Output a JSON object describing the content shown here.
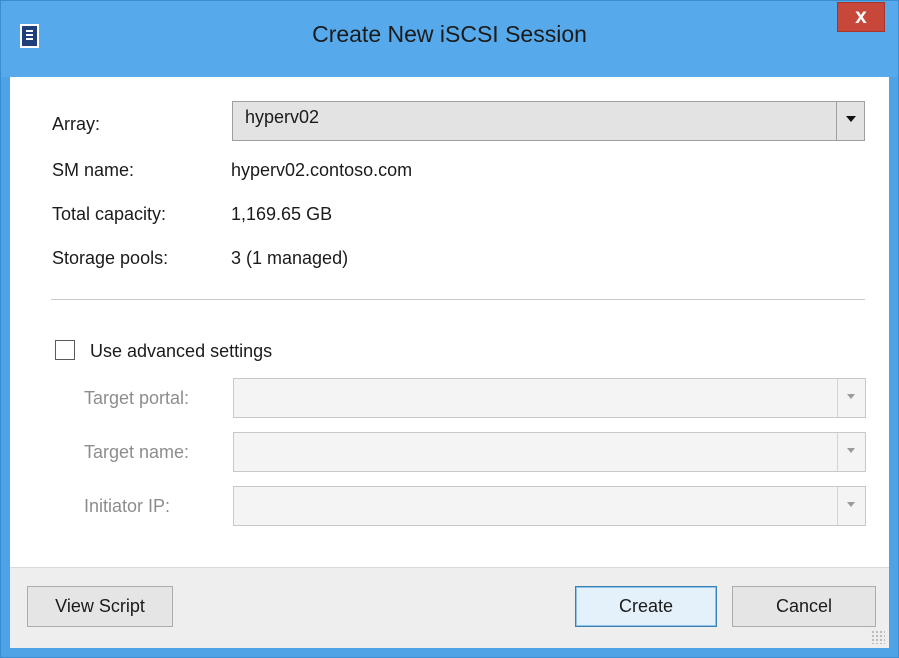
{
  "window": {
    "title": "Create New iSCSI Session",
    "close_label": "x"
  },
  "array": {
    "label": "Array:",
    "selected": "hyperv02"
  },
  "info": {
    "sm_name_label": "SM name:",
    "sm_name_value": "hyperv02.contoso.com",
    "total_capacity_label": "Total capacity:",
    "total_capacity_value": "1,169.65 GB",
    "storage_pools_label": "Storage pools:",
    "storage_pools_value": "3 (1 managed)"
  },
  "advanced": {
    "checkbox_label": "Use advanced settings",
    "checked": false,
    "target_portal_label": "Target portal:",
    "target_portal_value": "",
    "target_name_label": "Target name:",
    "target_name_value": "",
    "initiator_ip_label": "Initiator IP:",
    "initiator_ip_value": ""
  },
  "footer": {
    "view_script_label": "View Script",
    "create_label": "Create",
    "cancel_label": "Cancel"
  },
  "colors": {
    "title_bar": "#56aaeb",
    "close_button": "#c7473b",
    "default_button_border": "#3c7fb1"
  },
  "icons": {
    "app": "app-window-icon",
    "close": "close-icon",
    "dropdown": "chevron-down-icon",
    "grip": "resize-grip-icon"
  }
}
